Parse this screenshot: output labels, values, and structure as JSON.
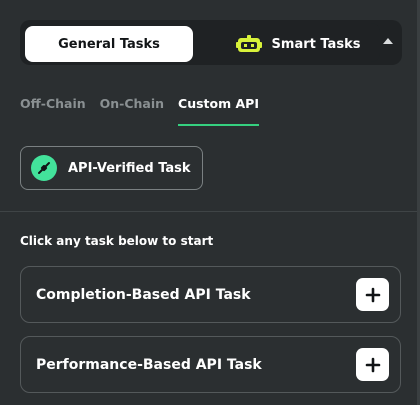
{
  "tabs_top": {
    "general_label": "General Tasks",
    "smart_label": "Smart Tasks",
    "active": "general"
  },
  "subtabs": {
    "items": [
      {
        "label": "Off-Chain",
        "active": false
      },
      {
        "label": "On-Chain",
        "active": false
      },
      {
        "label": "Custom API",
        "active": true
      }
    ]
  },
  "api_chip": {
    "label": "API-Verified Task",
    "icon": "plug-icon"
  },
  "hint": "Click any task below to start",
  "tasks": [
    {
      "label": "Completion-Based API Task",
      "icon": "plus-icon"
    },
    {
      "label": "Performance-Based API Task",
      "icon": "plus-icon"
    }
  ],
  "colors": {
    "background": "#2b2f31",
    "accent": "#35d07f",
    "icon_green": "#43e29b",
    "robot_yellow": "#d8f23a"
  }
}
